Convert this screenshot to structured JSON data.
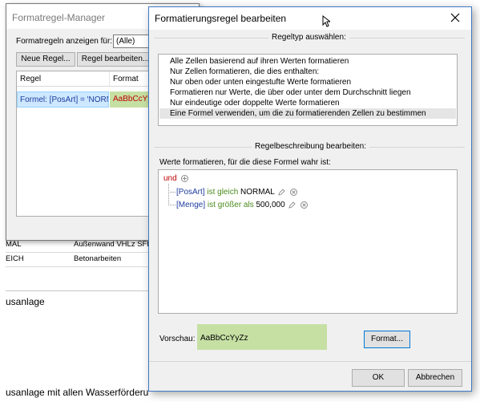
{
  "background_doc": {
    "rows": [
      {
        "code": "MAL",
        "description": "Außenwand VHLz SFK"
      },
      {
        "code": "EICH",
        "description": "Betonarbeiten"
      }
    ],
    "heading_1": "usanlage",
    "heading_2": "usanlage mit allen Wasserförderungen ... als Eingeschoss mit"
  },
  "rules_manager": {
    "title": "Formatregel-Manager",
    "show_rules_label": "Formatregeln anzeigen für:",
    "show_rules_value": "(Alle)",
    "new_rule_button": "Neue Regel...",
    "edit_rule_button": "Regel bearbeiten...",
    "columns": [
      "Regel",
      "Format"
    ],
    "rule_row": {
      "rule": "Formel: [PosArt] = 'NORM",
      "format_preview": "AaBbCcYy"
    }
  },
  "edit_dialog": {
    "title": "Formatierungsregel bearbeiten",
    "close_icon": "close-icon",
    "rule_type_group_label": "Regeltyp auswählen:",
    "rule_types": [
      "Alle Zellen basierend auf ihren Werten formatieren",
      "Nur Zellen formatieren, die dies enthalten:",
      "Nur oben oder unten eingestufte Werte formatieren",
      "Formatieren nur Werte, die über oder unter dem Durchschnitt liegen",
      "Nur eindeutige oder doppelte Werte formatieren",
      "Eine Formel verwenden, um die zu formatierenden Zellen zu bestimmen"
    ],
    "selected_rule_type_index": 5,
    "description_group_label": "Regelbeschreibung bearbeiten:",
    "formula_label": "Werte formatieren, für die diese Formel wahr ist:",
    "condition_root": "und",
    "conditions": [
      {
        "field": "[PosArt]",
        "operator": "ist gleich",
        "value": "NORMAL"
      },
      {
        "field": "[Menge]",
        "operator": "ist größer als",
        "value": "500,000"
      }
    ],
    "preview_label": "Vorschau:",
    "preview_text": "AaBbCcYyZz",
    "preview_color": "#c6e0a4",
    "format_button": "Format...",
    "ok_button": "OK",
    "cancel_button": "Abbrechen"
  }
}
